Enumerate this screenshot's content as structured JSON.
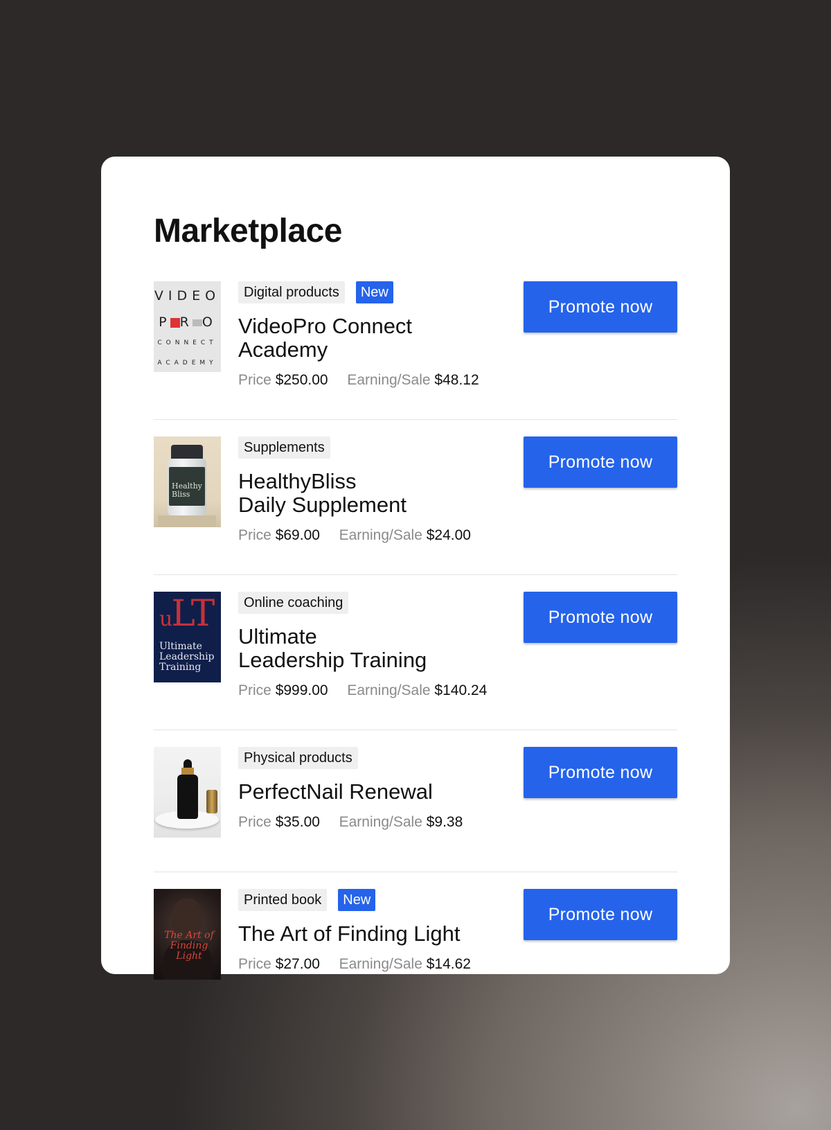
{
  "title": "Marketplace",
  "labels": {
    "price": "Price",
    "earning": "Earning/Sale",
    "promote": "Promote now",
    "new_badge": "New"
  },
  "colors": {
    "accent": "#2563eb",
    "tag_bg": "#efefef",
    "muted_label": "#8a8a8a"
  },
  "products": [
    {
      "category": "Digital products",
      "is_new": true,
      "name_line1": "VideoPro Connect",
      "name_line2": "Academy",
      "price": "$250.00",
      "earning": "$48.12",
      "thumb": {
        "l1": "VIDEO",
        "l2a": "P",
        "l2b": "R",
        "l2c": "O",
        "l3": "CONNECT",
        "l4": "ACADEMY"
      }
    },
    {
      "category": "Supplements",
      "is_new": false,
      "name_line1": "HealthyBliss",
      "name_line2": "Daily Supplement",
      "price": "$69.00",
      "earning": "$24.00",
      "thumb": {
        "l1": "Healthy",
        "l2": "Bliss"
      }
    },
    {
      "category": "Online coaching",
      "is_new": false,
      "name_line1": "Ultimate",
      "name_line2": "Leadership Training",
      "price": "$999.00",
      "earning": "$140.24",
      "thumb": {
        "mono_a": "u",
        "mono_b": "L",
        "mono_c": "T",
        "l1": "Ultimate",
        "l2": "Leadership",
        "l3": "Training"
      }
    },
    {
      "category": "Physical products",
      "is_new": false,
      "name_line1": "PerfectNail Renewal",
      "name_line2": "",
      "price": "$35.00",
      "earning": "$9.38"
    },
    {
      "category": "Printed book",
      "is_new": true,
      "name_line1": "The Art of Finding Light",
      "name_line2": "",
      "price": "$27.00",
      "earning": "$14.62",
      "thumb": {
        "l1": "The Art of",
        "l2": "Finding Light"
      }
    }
  ]
}
